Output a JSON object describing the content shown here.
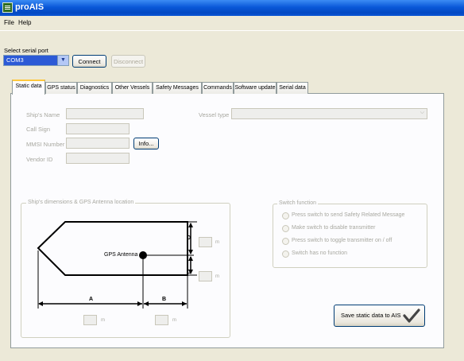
{
  "window": {
    "title": "proAIS"
  },
  "menu": [
    "File",
    "Help"
  ],
  "serial": {
    "label": "Select serial port",
    "port": "COM3",
    "connect": "Connect",
    "disconnect": "Disconnect"
  },
  "tabs": [
    "Static data",
    "GPS status",
    "Diagnostics",
    "Other Vessels",
    "Safety Messages",
    "Commands",
    "Software update",
    "Serial data"
  ],
  "static": {
    "ships_name": "Ship's Name",
    "call_sign": "Call Sign",
    "mmsi": "MMSI Number",
    "vendor_id": "Vendor ID",
    "info": "Info...",
    "vessel_type": "Vessel type"
  },
  "dimensions": {
    "legend": "Ship's dimensions & GPS Antenna location",
    "gps_label": "GPS Antenna",
    "A": "A",
    "B": "B",
    "C": "C",
    "D": "D",
    "unit": "m"
  },
  "switch": {
    "legend": "Switch function",
    "options": [
      "Press switch to send Safety Related Message",
      "Make switch to disable transmitter",
      "Press switch to toggle transmitter on / off",
      "Switch has no function"
    ]
  },
  "save_label": "Save static data to AIS"
}
